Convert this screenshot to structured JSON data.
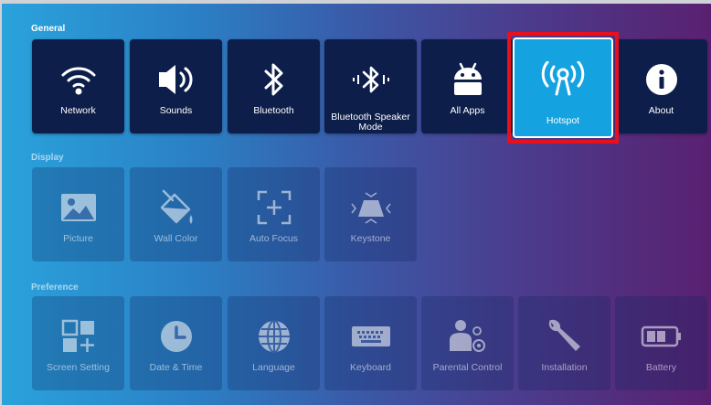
{
  "sections": {
    "general": "General",
    "display": "Display",
    "preference": "Preference"
  },
  "general": [
    {
      "label": "Network",
      "icon": "wifi-icon"
    },
    {
      "label": "Sounds",
      "icon": "speaker-icon"
    },
    {
      "label": "Bluetooth",
      "icon": "bluetooth-icon"
    },
    {
      "label": "Bluetooth Speaker Mode",
      "icon": "bluetooth-speaker-icon"
    },
    {
      "label": "All Apps",
      "icon": "android-icon"
    },
    {
      "label": "Hotspot",
      "icon": "hotspot-icon"
    },
    {
      "label": "About",
      "icon": "info-icon"
    }
  ],
  "display": [
    {
      "label": "Picture",
      "icon": "picture-icon"
    },
    {
      "label": "Wall Color",
      "icon": "paint-bucket-icon"
    },
    {
      "label": "Auto Focus",
      "icon": "focus-icon"
    },
    {
      "label": "Keystone",
      "icon": "keystone-icon"
    }
  ],
  "preference": [
    {
      "label": "Screen Setting",
      "icon": "screen-setting-icon"
    },
    {
      "label": "Date & Time",
      "icon": "clock-icon"
    },
    {
      "label": "Language",
      "icon": "globe-icon"
    },
    {
      "label": "Keyboard",
      "icon": "keyboard-icon"
    },
    {
      "label": "Parental Control",
      "icon": "parental-control-icon"
    },
    {
      "label": "Installation",
      "icon": "wrench-icon"
    },
    {
      "label": "Battery",
      "icon": "battery-icon"
    }
  ],
  "colors": {
    "tile_dark": "#0d1e4a",
    "selected": "#14a3e0",
    "highlight": "#e8101c"
  }
}
